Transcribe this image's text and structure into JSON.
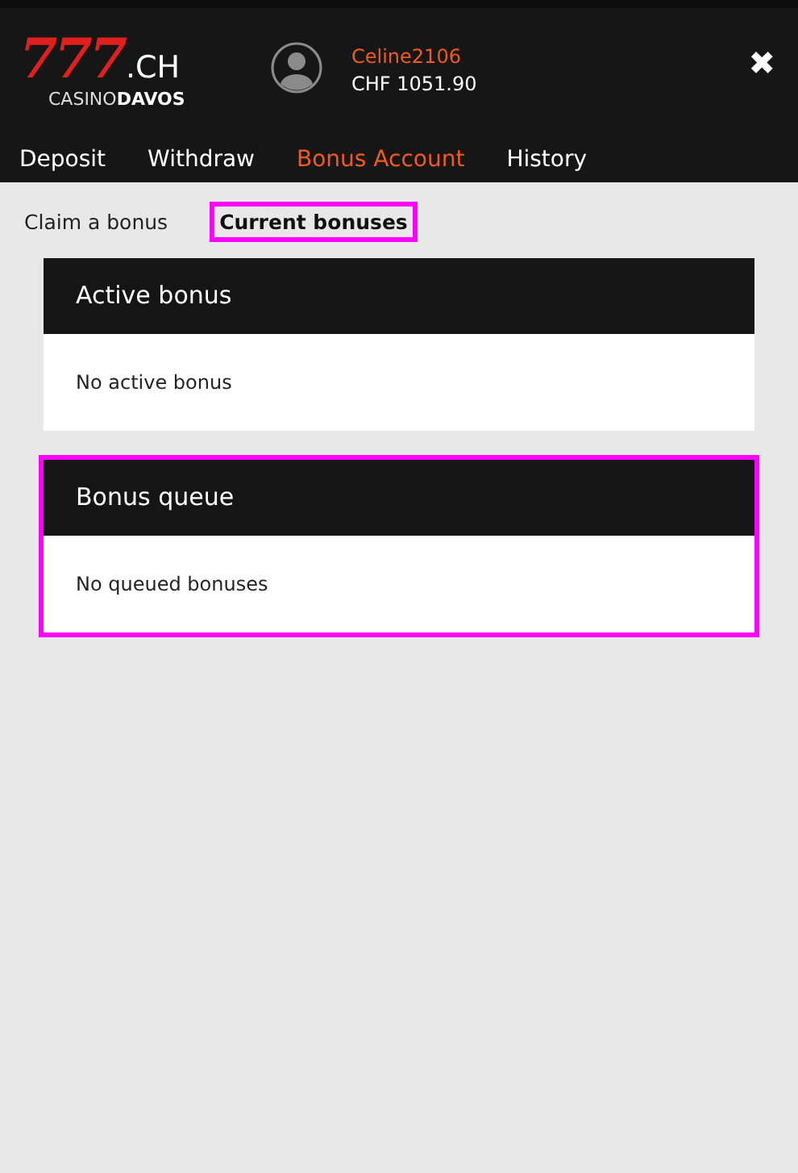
{
  "logo": {
    "number": "777",
    "domain": ".CH",
    "casino": "CASINO",
    "place": "DAVOS"
  },
  "user": {
    "name": "Celine2106",
    "balance": "CHF 1051.90"
  },
  "close": "✖",
  "nav": [
    {
      "label": "Deposit",
      "selected": false
    },
    {
      "label": "Withdraw",
      "selected": false
    },
    {
      "label": "Bonus Account",
      "selected": true
    },
    {
      "label": "History",
      "selected": false
    }
  ],
  "subtabs": [
    {
      "label": "Claim a bonus",
      "selected": false,
      "highlighted": false
    },
    {
      "label": "Current bonuses",
      "selected": true,
      "highlighted": true
    }
  ],
  "panels": [
    {
      "title": "Active bonus",
      "message": "No active bonus",
      "highlighted": false
    },
    {
      "title": "Bonus queue",
      "message": "No queued bonuses",
      "highlighted": true
    }
  ]
}
